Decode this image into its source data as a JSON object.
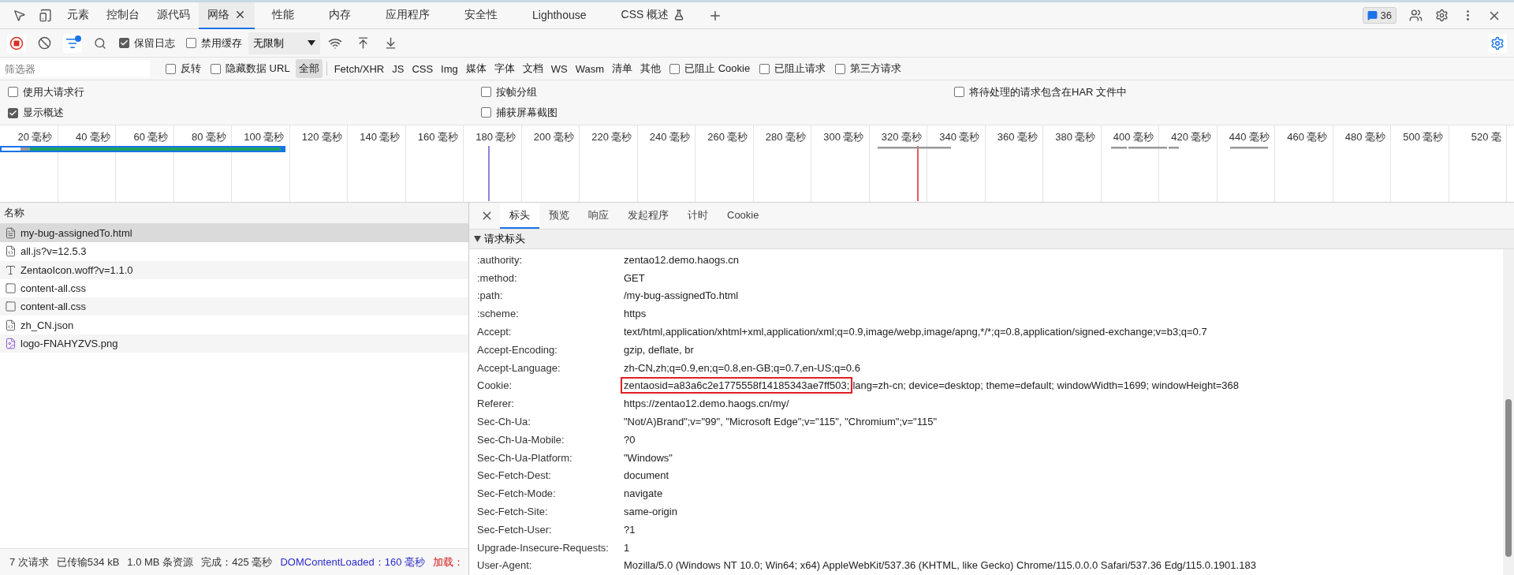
{
  "tabs": [
    {
      "label": "元素",
      "selected": false
    },
    {
      "label": "控制台",
      "selected": false
    },
    {
      "label": "源代码",
      "selected": false
    },
    {
      "label": "网络",
      "selected": true,
      "closable": true
    },
    {
      "label": "性能",
      "selected": false
    },
    {
      "label": "内存",
      "selected": false
    },
    {
      "label": "应用程序",
      "selected": false
    },
    {
      "label": "安全性",
      "selected": false
    },
    {
      "label": "Lighthouse",
      "selected": false
    },
    {
      "label": "CSS 概述",
      "selected": false,
      "experimental": true
    }
  ],
  "issues_badge": {
    "count": "36"
  },
  "toolbar": {
    "recording": true,
    "filter_active": true,
    "preserve_log": {
      "label": "保留日志",
      "checked": true
    },
    "disable_cache": {
      "label": "禁用缓存",
      "checked": false
    },
    "throttling": "无限制"
  },
  "filter": {
    "placeholder": "筛选器",
    "toggles": [
      {
        "label": "反转",
        "checked": false
      },
      {
        "label": "隐藏数据 URL",
        "checked": false
      }
    ],
    "types": [
      {
        "label": "全部",
        "selected": true
      },
      {
        "label": "Fetch/XHR",
        "selected": false
      },
      {
        "label": "JS",
        "selected": false
      },
      {
        "label": "CSS",
        "selected": false
      },
      {
        "label": "Img",
        "selected": false
      },
      {
        "label": "媒体",
        "selected": false
      },
      {
        "label": "字体",
        "selected": false
      },
      {
        "label": "文档",
        "selected": false
      },
      {
        "label": "WS",
        "selected": false
      },
      {
        "label": "Wasm",
        "selected": false
      },
      {
        "label": "清单",
        "selected": false
      },
      {
        "label": "其他",
        "selected": false
      }
    ],
    "extra": [
      {
        "label": "已阻止 Cookie",
        "checked": false
      },
      {
        "label": "已阻止请求",
        "checked": false
      },
      {
        "label": "第三方请求",
        "checked": false
      }
    ]
  },
  "settings": [
    [
      {
        "label": "使用大请求行",
        "checked": false
      },
      {
        "label": "按帧分组",
        "checked": false
      },
      {
        "label": "将待处理的请求包含在HAR 文件中",
        "checked": false
      }
    ],
    [
      {
        "label": "显示概述",
        "checked": true
      },
      {
        "label": "捕获屏幕截图",
        "checked": false
      }
    ]
  ],
  "overview": {
    "ticks": [
      "20 毫秒",
      "40 毫秒",
      "60 毫秒",
      "80 毫秒",
      "100 毫秒",
      "120 毫秒",
      "140 毫秒",
      "160 毫秒",
      "180 毫秒",
      "200 毫秒",
      "220 毫秒",
      "240 毫秒",
      "260 毫秒",
      "280 毫秒",
      "300 毫秒",
      "320 毫秒",
      "340 毫秒",
      "360 毫秒",
      "380 毫秒",
      "400 毫秒",
      "420 毫秒",
      "440 毫秒",
      "460 毫秒",
      "480 毫秒",
      "500 毫秒",
      "520 毫"
    ]
  },
  "requests": {
    "column": "名称",
    "rows": [
      {
        "name": "my-bug-assignedTo.html",
        "kind": "document",
        "selected": true
      },
      {
        "name": "all.js?v=12.5.3",
        "kind": "script",
        "selected": false
      },
      {
        "name": "ZentaoIcon.woff?v=1.1.0",
        "kind": "font",
        "selected": false
      },
      {
        "name": "content-all.css",
        "kind": "stylesheet",
        "selected": false
      },
      {
        "name": "content-all.css",
        "kind": "stylesheet",
        "selected": false
      },
      {
        "name": "zh_CN.json",
        "kind": "script",
        "selected": false
      },
      {
        "name": "logo-FNAHYZVS.png",
        "kind": "image",
        "selected": false
      }
    ]
  },
  "status_bar": [
    {
      "text": "7 次请求",
      "kind": "plain"
    },
    {
      "text": "已传输534 kB",
      "kind": "plain"
    },
    {
      "text": "1.0 MB 条资源",
      "kind": "plain"
    },
    {
      "text": "完成：425 毫秒",
      "kind": "plain"
    },
    {
      "text": "DOMContentLoaded：160 毫秒",
      "kind": "dom"
    },
    {
      "text": "加载：",
      "kind": "load"
    }
  ],
  "details": {
    "tabs": [
      {
        "label": "标头",
        "selected": true
      },
      {
        "label": "预览",
        "selected": false
      },
      {
        "label": "响应",
        "selected": false
      },
      {
        "label": "发起程序",
        "selected": false
      },
      {
        "label": "计时",
        "selected": false
      },
      {
        "label": "Cookie",
        "selected": false
      }
    ],
    "section": {
      "title": "请求标头",
      "expanded": true,
      "headers": [
        {
          "name": ":authority:",
          "value": "zentao12.demo.haogs.cn"
        },
        {
          "name": ":method:",
          "value": "GET"
        },
        {
          "name": ":path:",
          "value": "/my-bug-assignedTo.html"
        },
        {
          "name": ":scheme:",
          "value": "https"
        },
        {
          "name": "Accept:",
          "value": "text/html,application/xhtml+xml,application/xml;q=0.9,image/webp,image/apng,*/*;q=0.8,application/signed-exchange;v=b3;q=0.7"
        },
        {
          "name": "Accept-Encoding:",
          "value": "gzip, deflate, br"
        },
        {
          "name": "Accept-Language:",
          "value": "zh-CN,zh;q=0.9,en;q=0.8,en-GB;q=0.7,en-US;q=0.6"
        },
        {
          "name": "Cookie:",
          "highlighted": "zentaosid=a83a6c2e1775558f14185343ae7ff503;",
          "value": "lang=zh-cn; device=desktop; theme=default; windowWidth=1699; windowHeight=368"
        },
        {
          "name": "Referer:",
          "value": "https://zentao12.demo.haogs.cn/my/"
        },
        {
          "name": "Sec-Ch-Ua:",
          "value": "\"Not/A)Brand\";v=\"99\", \"Microsoft Edge\";v=\"115\", \"Chromium\";v=\"115\""
        },
        {
          "name": "Sec-Ch-Ua-Mobile:",
          "value": "?0"
        },
        {
          "name": "Sec-Ch-Ua-Platform:",
          "value": "\"Windows\""
        },
        {
          "name": "Sec-Fetch-Dest:",
          "value": "document"
        },
        {
          "name": "Sec-Fetch-Mode:",
          "value": "navigate"
        },
        {
          "name": "Sec-Fetch-Site:",
          "value": "same-origin"
        },
        {
          "name": "Sec-Fetch-User:",
          "value": "?1"
        },
        {
          "name": "Upgrade-Insecure-Requests:",
          "value": "1"
        },
        {
          "name": "User-Agent:",
          "value": "Mozilla/5.0 (Windows NT 10.0; Win64; x64) AppleWebKit/537.36 (KHTML, like Gecko) Chrome/115.0.0.0 Safari/537.36 Edg/115.0.1901.183"
        }
      ]
    }
  }
}
